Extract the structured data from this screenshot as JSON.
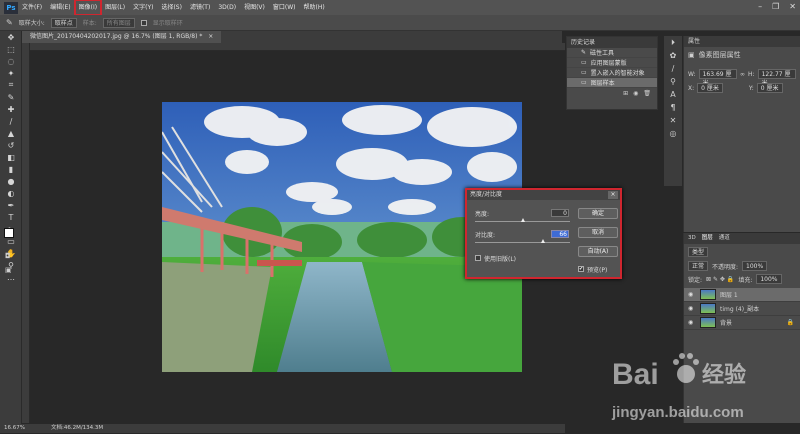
{
  "app": {
    "logo": "Ps"
  },
  "menu": [
    "文件(F)",
    "编辑(E)",
    "图像(I)",
    "图层(L)",
    "文字(Y)",
    "选择(S)",
    "滤镜(T)",
    "3D(D)",
    "视图(V)",
    "窗口(W)",
    "帮助(H)"
  ],
  "options": {
    "sample_size_label": "取样大小:",
    "sample_size_value": "取样点",
    "sample_label": "样本:",
    "sample_value": "所有图层",
    "ring_label": "显示取样环"
  },
  "document": {
    "tab_title": "微信图片_20170404202017.jpg @ 16.7% (图层 1, RGB/8) *",
    "close": "×"
  },
  "status": {
    "zoom": "16.67%",
    "doc_size": "文档:46.2M/134.3M"
  },
  "history": {
    "title": "历史记录",
    "items": [
      "磁性工具",
      "应用图层蒙版",
      "置入嵌入的智能对象",
      "图层样本"
    ]
  },
  "properties": {
    "title": "属性",
    "subtitle": "像素图层属性",
    "w_label": "W:",
    "w_value": "163.69 厘米",
    "h_label": "H:",
    "h_value": "122.77 厘米",
    "x_label": "X:",
    "x_value": "0 厘米",
    "y_label": "Y:",
    "y_value": "0 厘米"
  },
  "layers": {
    "tabs": [
      "3D",
      "图层",
      "通道"
    ],
    "kind": "类型",
    "blend": "正常",
    "opacity_label": "不透明度:",
    "opacity": "100%",
    "lock_label": "锁定:",
    "fill_label": "填充:",
    "fill": "100%",
    "rows": [
      {
        "name": "图层 1"
      },
      {
        "name": "timg (4)_副本"
      },
      {
        "name": "背景"
      }
    ]
  },
  "dialog": {
    "title": "亮度/对比度",
    "close": "×",
    "brightness_label": "亮度:",
    "brightness_value": "0",
    "brightness_level": 0.5,
    "contrast_label": "对比度:",
    "contrast_value": "66",
    "contrast_level": 0.72,
    "legacy_label": "使用旧版(L)",
    "legacy_checked": false,
    "ok": "确定",
    "cancel": "取消",
    "auto": "自动(A)",
    "preview_label": "预览(P)",
    "preview_checked": true
  },
  "watermark": {
    "brand": "Bai",
    "brand2": "经验",
    "url": "jingyan.baidu.com"
  },
  "colors": {
    "highlight": "#d0262f",
    "accent": "#3e6bd6"
  }
}
